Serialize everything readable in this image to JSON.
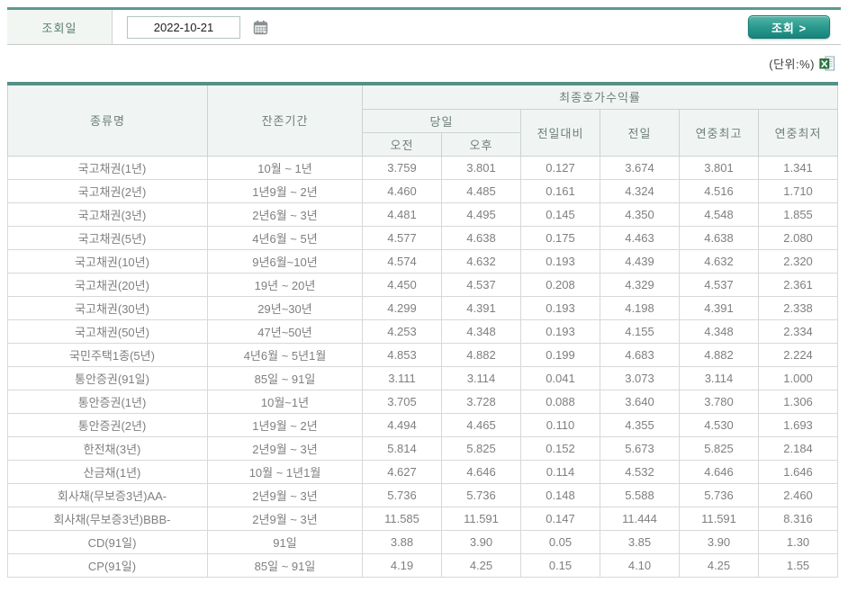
{
  "toolbar": {
    "date_label": "조회일",
    "date_value": "2022-10-21",
    "search_button": "조회 >"
  },
  "meta": {
    "unit_note": "(단위:%)"
  },
  "table": {
    "headers": {
      "type_name": "종류명",
      "maturity": "잔존기간",
      "yield_group": "최종호가수익률",
      "today": "당일",
      "am": "오전",
      "pm": "오후",
      "change_vs_prev": "전일대비",
      "prev_day": "전일",
      "year_high": "연중최고",
      "year_low": "연중최저"
    },
    "rows": [
      {
        "name": "국고채권(1년)",
        "maturity": "10월 ~ 1년",
        "am": "3.759",
        "pm": "3.801",
        "change": "0.127",
        "prev": "3.674",
        "high": "3.801",
        "low": "1.341"
      },
      {
        "name": "국고채권(2년)",
        "maturity": "1년9월 ~ 2년",
        "am": "4.460",
        "pm": "4.485",
        "change": "0.161",
        "prev": "4.324",
        "high": "4.516",
        "low": "1.710"
      },
      {
        "name": "국고채권(3년)",
        "maturity": "2년6월 ~ 3년",
        "am": "4.481",
        "pm": "4.495",
        "change": "0.145",
        "prev": "4.350",
        "high": "4.548",
        "low": "1.855"
      },
      {
        "name": "국고채권(5년)",
        "maturity": "4년6월 ~ 5년",
        "am": "4.577",
        "pm": "4.638",
        "change": "0.175",
        "prev": "4.463",
        "high": "4.638",
        "low": "2.080"
      },
      {
        "name": "국고채권(10년)",
        "maturity": "9년6월~10년",
        "am": "4.574",
        "pm": "4.632",
        "change": "0.193",
        "prev": "4.439",
        "high": "4.632",
        "low": "2.320"
      },
      {
        "name": "국고채권(20년)",
        "maturity": "19년 ~ 20년",
        "am": "4.450",
        "pm": "4.537",
        "change": "0.208",
        "prev": "4.329",
        "high": "4.537",
        "low": "2.361"
      },
      {
        "name": "국고채권(30년)",
        "maturity": "29년~30년",
        "am": "4.299",
        "pm": "4.391",
        "change": "0.193",
        "prev": "4.198",
        "high": "4.391",
        "low": "2.338"
      },
      {
        "name": "국고채권(50년)",
        "maturity": "47년~50년",
        "am": "4.253",
        "pm": "4.348",
        "change": "0.193",
        "prev": "4.155",
        "high": "4.348",
        "low": "2.334"
      },
      {
        "name": "국민주택1종(5년)",
        "maturity": "4년6월 ~ 5년1월",
        "am": "4.853",
        "pm": "4.882",
        "change": "0.199",
        "prev": "4.683",
        "high": "4.882",
        "low": "2.224"
      },
      {
        "name": "통안증권(91일)",
        "maturity": "85일 ~ 91일",
        "am": "3.111",
        "pm": "3.114",
        "change": "0.041",
        "prev": "3.073",
        "high": "3.114",
        "low": "1.000"
      },
      {
        "name": "통안증권(1년)",
        "maturity": "10월~1년",
        "am": "3.705",
        "pm": "3.728",
        "change": "0.088",
        "prev": "3.640",
        "high": "3.780",
        "low": "1.306"
      },
      {
        "name": "통안증권(2년)",
        "maturity": "1년9월 ~ 2년",
        "am": "4.494",
        "pm": "4.465",
        "change": "0.110",
        "prev": "4.355",
        "high": "4.530",
        "low": "1.693"
      },
      {
        "name": "한전채(3년)",
        "maturity": "2년9월 ~ 3년",
        "am": "5.814",
        "pm": "5.825",
        "change": "0.152",
        "prev": "5.673",
        "high": "5.825",
        "low": "2.184"
      },
      {
        "name": "산금채(1년)",
        "maturity": "10월 ~ 1년1월",
        "am": "4.627",
        "pm": "4.646",
        "change": "0.114",
        "prev": "4.532",
        "high": "4.646",
        "low": "1.646"
      },
      {
        "name": "회사채(무보증3년)AA-",
        "maturity": "2년9월 ~ 3년",
        "am": "5.736",
        "pm": "5.736",
        "change": "0.148",
        "prev": "5.588",
        "high": "5.736",
        "low": "2.460"
      },
      {
        "name": "회사채(무보증3년)BBB-",
        "maturity": "2년9월 ~ 3년",
        "am": "11.585",
        "pm": "11.591",
        "change": "0.147",
        "prev": "11.444",
        "high": "11.591",
        "low": "8.316"
      },
      {
        "name": "CD(91일)",
        "maturity": "91일",
        "am": "3.88",
        "pm": "3.90",
        "change": "0.05",
        "prev": "3.85",
        "high": "3.90",
        "low": "1.30"
      },
      {
        "name": "CP(91일)",
        "maturity": "85일 ~ 91일",
        "am": "4.19",
        "pm": "4.25",
        "change": "0.15",
        "prev": "4.10",
        "high": "4.25",
        "low": "1.55"
      }
    ]
  },
  "colors": {
    "accent_teal": "#2f968a",
    "table_border_teal": "#569086",
    "value_red": "#d42f2f",
    "series_purple": "#7b2d8b",
    "muted_gray": "#7f7f7f"
  }
}
